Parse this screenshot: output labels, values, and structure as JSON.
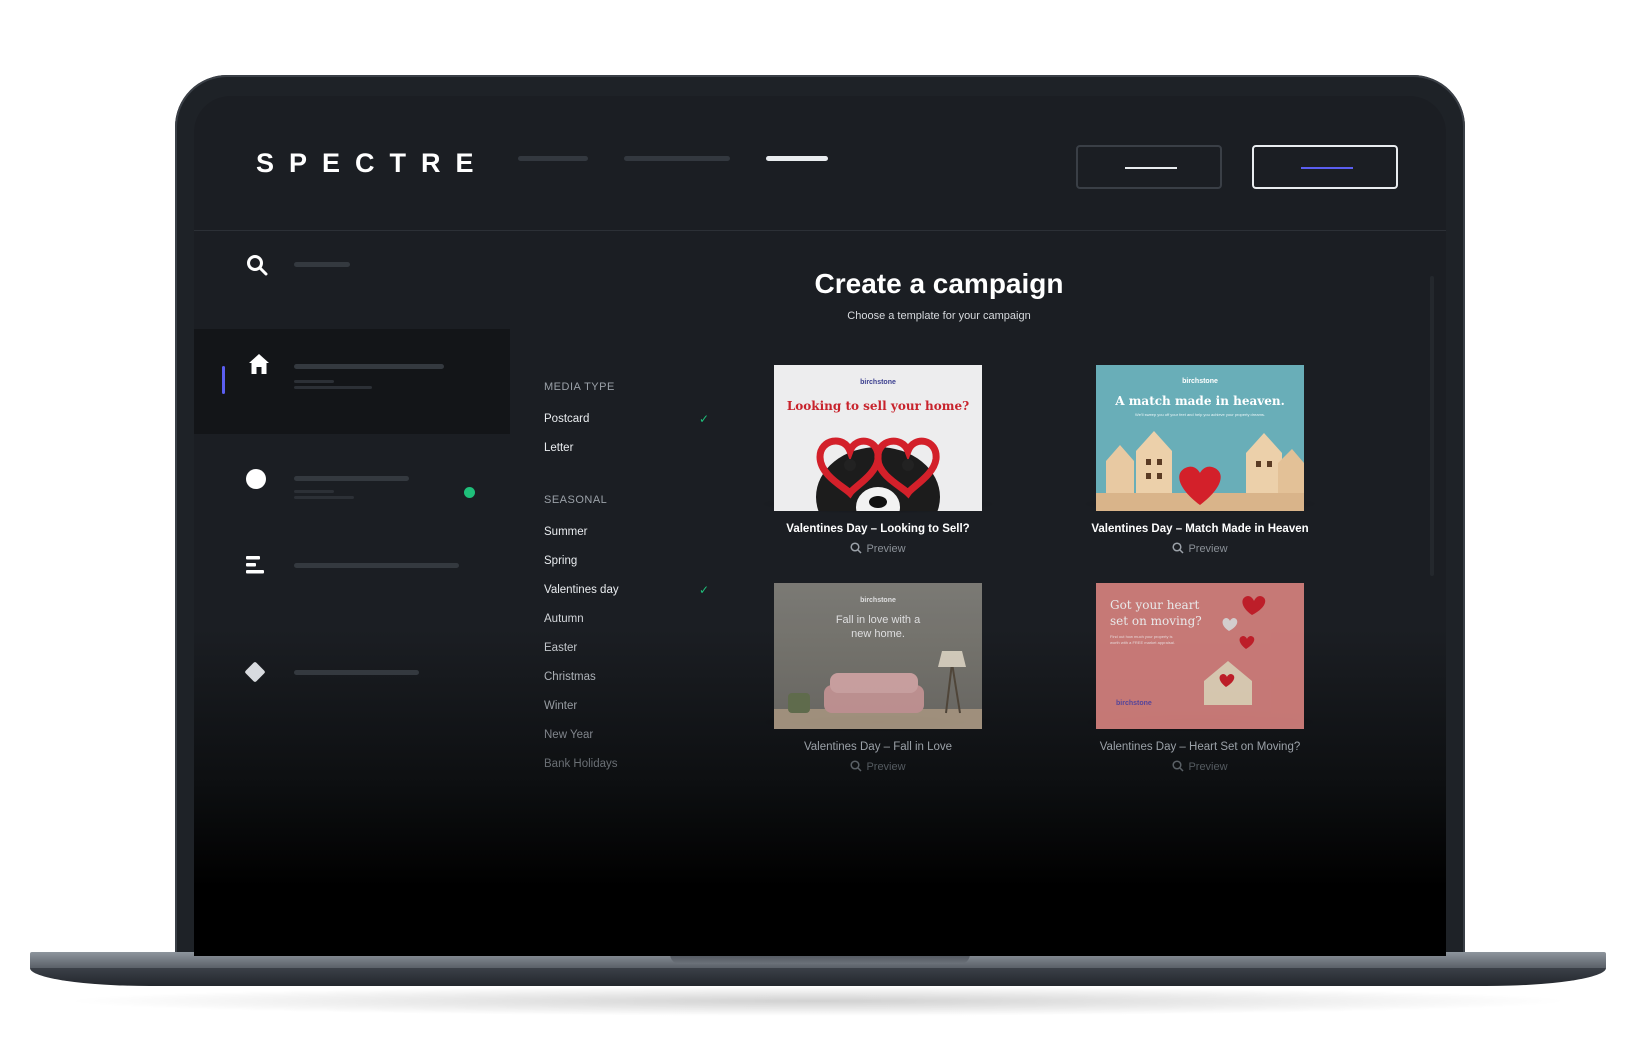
{
  "app": {
    "logo": "SPECTRE"
  },
  "page": {
    "title": "Create a campaign",
    "subtitle": "Choose a template for your campaign"
  },
  "filters": {
    "media_type": {
      "heading": "MEDIA TYPE",
      "items": [
        {
          "label": "Postcard",
          "checked": true
        },
        {
          "label": "Letter",
          "checked": false
        }
      ]
    },
    "seasonal": {
      "heading": "SEASONAL",
      "items": [
        {
          "label": "Summer",
          "checked": false
        },
        {
          "label": "Spring",
          "checked": false
        },
        {
          "label": "Valentines day",
          "checked": true
        },
        {
          "label": "Autumn",
          "checked": false
        },
        {
          "label": "Easter",
          "checked": false
        },
        {
          "label": "Christmas",
          "checked": false
        },
        {
          "label": "Winter",
          "checked": false
        },
        {
          "label": "New Year",
          "checked": false
        },
        {
          "label": "Bank Holidays",
          "checked": false
        }
      ]
    }
  },
  "templates": [
    {
      "title": "Valentines Day – Looking to Sell?",
      "preview": "Preview",
      "brand": "birchstone",
      "headline": "Looking to sell your home?"
    },
    {
      "title": "Valentines Day – Match Made in Heaven",
      "preview": "Preview",
      "brand": "birchstone",
      "headline": "A match made in heaven.",
      "subline": "We'll sweep you off your feet and help you achieve your property dreams."
    },
    {
      "title": "Valentines Day – Fall in Love",
      "preview": "Preview",
      "brand": "birchstone",
      "headline_1": "Fall in love with a",
      "headline_2": "new home."
    },
    {
      "title": "Valentines Day – Heart Set on Moving?",
      "preview": "Preview",
      "brand": "birchstone",
      "headline_1": "Got your heart",
      "headline_2": "set on moving?",
      "subline_1": "Find out how much your property is",
      "subline_2": "worth with a FREE market appraisal."
    }
  ],
  "colors": {
    "accent": "#5b5ef0",
    "success": "#1fbf7a",
    "screen_bg": "#1b1e23",
    "sidebar_active_bg": "#131518"
  },
  "icons": {
    "search": "search-icon",
    "home": "home-icon",
    "circle": "circle-icon",
    "list": "list-icon",
    "diamond": "diamond-icon",
    "check": "check-icon",
    "preview": "magnifier-icon"
  }
}
